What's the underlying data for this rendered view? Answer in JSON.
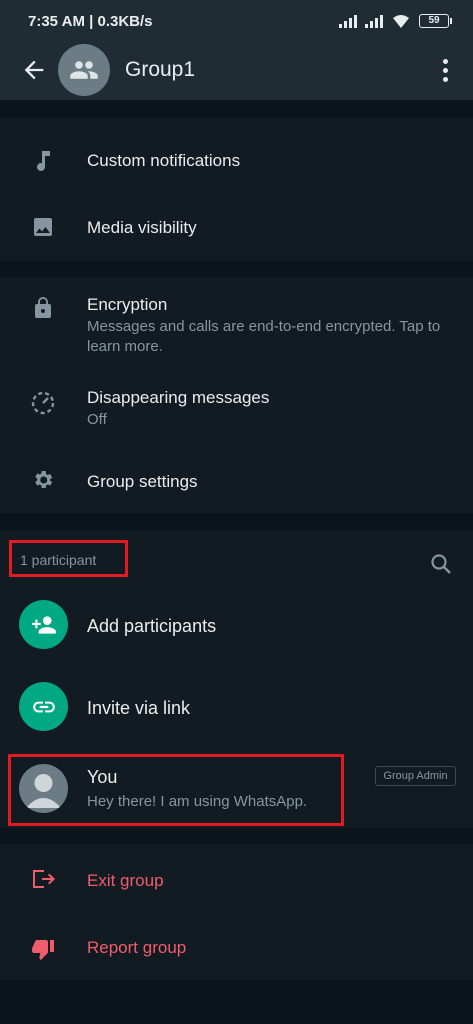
{
  "status_bar": {
    "time_info": "7:35 AM | 0.3KB/s",
    "battery": "59"
  },
  "header": {
    "title": "Group1"
  },
  "section_one": {
    "custom_notifications": "Custom notifications",
    "media_visibility": "Media visibility"
  },
  "section_two": {
    "encryption_title": "Encryption",
    "encryption_desc": "Messages and calls are end-to-end encrypted. Tap to learn more.",
    "disappearing_title": "Disappearing messages",
    "disappearing_value": "Off",
    "group_settings": "Group settings"
  },
  "participants": {
    "count_label": "1 participant",
    "add_label": "Add participants",
    "invite_label": "Invite via link",
    "members": [
      {
        "name": "You",
        "status": "Hey there! I am using WhatsApp.",
        "badge": "Group Admin"
      }
    ]
  },
  "danger_zone": {
    "exit_label": "Exit group",
    "report_label": "Report group"
  },
  "colors": {
    "accent": "#00a884",
    "danger": "#f15c6d",
    "highlight": "#e21b23",
    "background": "#0b141a",
    "surface": "#111b21"
  },
  "icons": [
    "back-arrow-icon",
    "group-icon",
    "kebab-menu-icon",
    "music-note-icon",
    "image-icon",
    "lock-icon",
    "timer-icon",
    "gear-icon",
    "search-icon",
    "add-person-icon",
    "link-icon",
    "person-icon",
    "exit-icon",
    "thumbs-down-icon"
  ]
}
